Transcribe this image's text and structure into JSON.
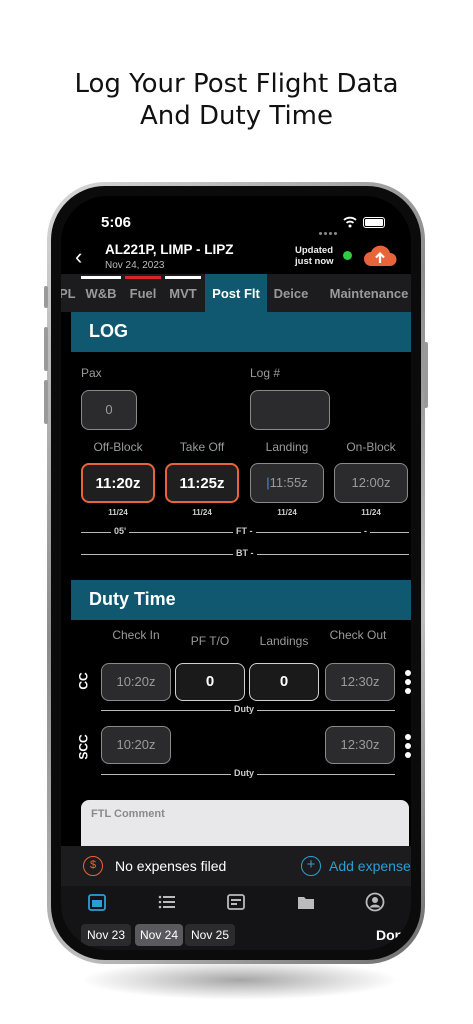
{
  "headline": {
    "line1": "Log Your Post Flight Data",
    "line2": "And Duty Time"
  },
  "status": {
    "time": "5:06"
  },
  "header": {
    "flight": "AL221P, LIMP - LIPZ",
    "date": "Nov 24, 2023",
    "updated_line1": "Updated",
    "updated_line2": "just now",
    "sync_color": "#2ecc40",
    "cloud_color": "#e8643a"
  },
  "tabs": [
    {
      "label": "PL"
    },
    {
      "label": "W&B"
    },
    {
      "label": "Fuel"
    },
    {
      "label": "MVT"
    },
    {
      "label": "Post Flt"
    },
    {
      "label": "Deice"
    },
    {
      "label": "Maintenance"
    }
  ],
  "log": {
    "title": "LOG",
    "pax_label": "Pax",
    "pax_value": "0",
    "log_label": "Log #",
    "log_value": "",
    "offblock_label": "Off-Block",
    "offblock_value": "11:20z",
    "offblock_date": "11/24",
    "takeoff_label": "Take Off",
    "takeoff_value": "11:25z",
    "takeoff_date": "11/24",
    "landing_label": "Landing",
    "landing_value": "11:55z",
    "landing_date": "11/24",
    "onblock_label": "On-Block",
    "onblock_value": "12:00z",
    "onblock_date": "11/24",
    "block_off": "05'",
    "ft": "FT -",
    "onblock_diff": "-",
    "bt": "BT -"
  },
  "duty": {
    "title": "Duty Time",
    "checkin_label": "Check In",
    "pfto_label": "PF T/O",
    "landings_label": "Landings",
    "checkout_label": "Check Out",
    "cc": {
      "label": "CC",
      "checkin": "10:20z",
      "pfto": "0",
      "landings": "0",
      "checkout": "12:30z",
      "duty_label": "Duty"
    },
    "scc": {
      "label": "SCC",
      "checkin": "10:20z",
      "checkout": "12:30z",
      "duty_label": "Duty"
    },
    "ftl_comment": "FTL Comment"
  },
  "expenses": {
    "status": "No expenses filed",
    "add_label": "Add expense",
    "accent": "#2a9fd6"
  },
  "dates": {
    "d1": "Nov 23",
    "d2": "Nov 24",
    "d3": "Nov 25",
    "done": "Done"
  }
}
